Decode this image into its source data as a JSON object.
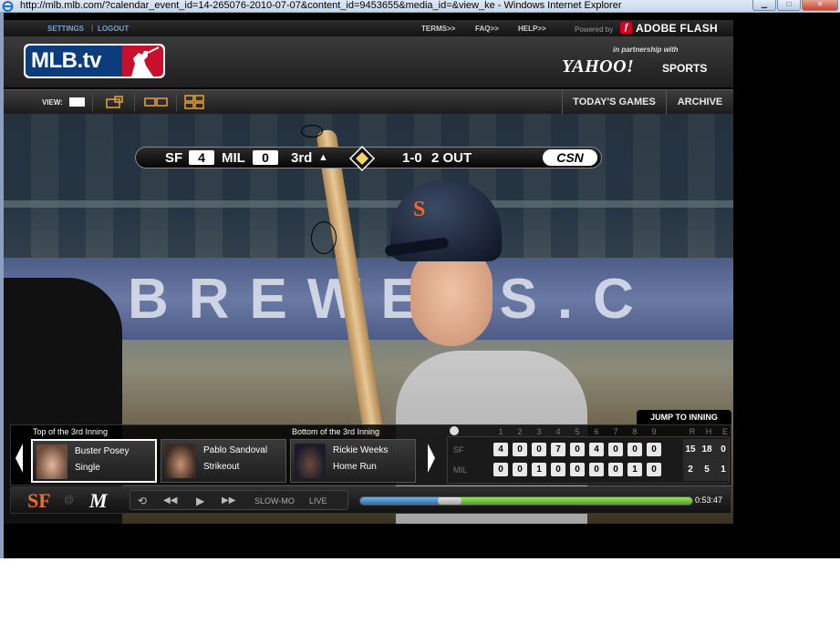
{
  "browser": {
    "title": "http://mlb.mlb.com/?calendar_event_id=14-265076-2010-07-07&content_id=9453655&media_id=&view_ke - Windows Internet Explorer"
  },
  "topbar": {
    "settings": "SETTINGS",
    "logout": "LOGOUT",
    "terms": "TERMS>>",
    "faq": "FAQ>>",
    "help": "HELP>>",
    "powered_by": "Powered by",
    "flash": "ADOBE FLASH"
  },
  "header": {
    "logo_text": "MLB.tv",
    "partner_text": "in partnership with",
    "yahoo": "YAHOO!",
    "sports": "SPORTS"
  },
  "navbar": {
    "view_label": "VIEW:",
    "todays_games": "TODAY'S GAMES",
    "archive": "ARCHIVE"
  },
  "scorebug": {
    "away_team": "SF",
    "away_score": "4",
    "home_team": "MIL",
    "home_score": "0",
    "inning": "3rd",
    "count": "1-0",
    "outs": "2 OUT",
    "network": "CSN"
  },
  "video": {
    "banner_text": "BREWERS.C"
  },
  "plays": {
    "jump_to_inning": "JUMP TO INNING",
    "top_label": "Top of the 3rd Inning",
    "bottom_label": "Bottom of the 3rd Inning",
    "cards": [
      {
        "player": "Buster Posey",
        "result": "Single",
        "selected": true
      },
      {
        "player": "Pablo Sandoval",
        "result": "Strikeout",
        "selected": false
      },
      {
        "player": "Rickie Weeks",
        "result": "Home Run",
        "selected": false
      }
    ]
  },
  "linescore": {
    "innings": [
      "1",
      "2",
      "3",
      "4",
      "5",
      "6",
      "7",
      "8",
      "9"
    ],
    "rhe_headers": [
      "R",
      "H",
      "E"
    ],
    "teams": [
      {
        "name": "SF",
        "runs": [
          "4",
          "0",
          "0",
          "7",
          "0",
          "4",
          "0",
          "0",
          "0"
        ],
        "rhe": [
          "15",
          "18",
          "0"
        ]
      },
      {
        "name": "MIL",
        "runs": [
          "0",
          "0",
          "1",
          "0",
          "0",
          "0",
          "0",
          "1",
          "0"
        ],
        "rhe": [
          "2",
          "5",
          "1"
        ]
      }
    ]
  },
  "controls": {
    "away_logo": "SF",
    "at": "@",
    "home_logo": "M",
    "slowmo": "SLOW-MO",
    "live": "LIVE",
    "timecode": "0:53:47",
    "played_fraction": 0.27,
    "buffered_fraction": 1.0
  },
  "colors": {
    "link_blue": "#6aa6dd",
    "mlb_blue": "#0b3c7d",
    "mlb_red": "#c8102e",
    "giants_orange": "#f26b2a",
    "progress_blue": "#2c6fb0",
    "progress_green": "#4aa31f"
  }
}
